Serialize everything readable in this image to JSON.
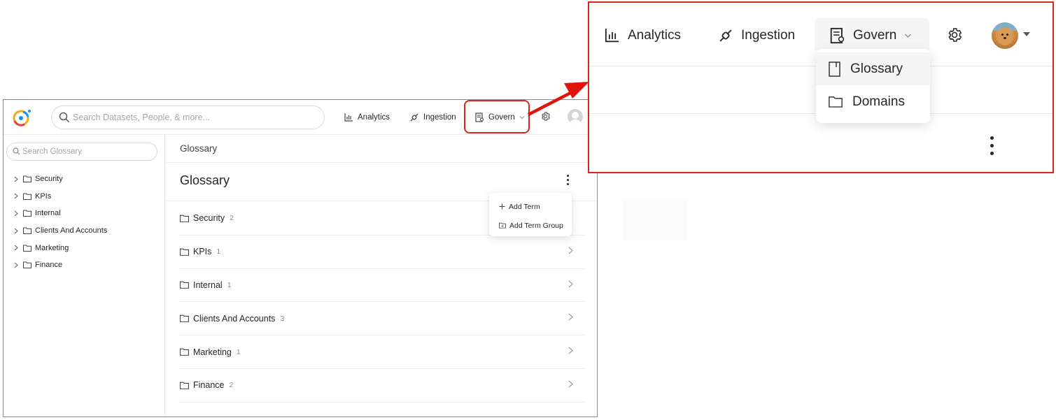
{
  "topbar": {
    "search_placeholder": "Search Datasets, People, & more...",
    "nav": {
      "analytics": "Analytics",
      "ingestion": "Ingestion",
      "govern": "Govern"
    }
  },
  "sidebar": {
    "search_placeholder": "Search Glossary",
    "items": [
      {
        "label": "Security"
      },
      {
        "label": "KPIs"
      },
      {
        "label": "Internal"
      },
      {
        "label": "Clients And Accounts"
      },
      {
        "label": "Marketing"
      },
      {
        "label": "Finance"
      }
    ]
  },
  "content": {
    "breadcrumb": "Glossary",
    "title": "Glossary",
    "rows": [
      {
        "label": "Security",
        "count": "2"
      },
      {
        "label": "KPIs",
        "count": "1"
      },
      {
        "label": "Internal",
        "count": "1"
      },
      {
        "label": "Clients And Accounts",
        "count": "3"
      },
      {
        "label": "Marketing",
        "count": "1"
      },
      {
        "label": "Finance",
        "count": "2"
      }
    ],
    "actions_menu": {
      "add_term": "Add Term",
      "add_term_group": "Add Term Group"
    }
  },
  "zoom": {
    "nav": {
      "analytics": "Analytics",
      "ingestion": "Ingestion",
      "govern": "Govern"
    },
    "govern_menu": {
      "glossary": "Glossary",
      "domains": "Domains"
    }
  },
  "colors": {
    "highlight": "#d9261c",
    "text": "#262626",
    "muted": "#8c8c8c",
    "logo_orange": "#f5a623",
    "logo_blue": "#1890ff",
    "logo_red": "#e8433a"
  }
}
